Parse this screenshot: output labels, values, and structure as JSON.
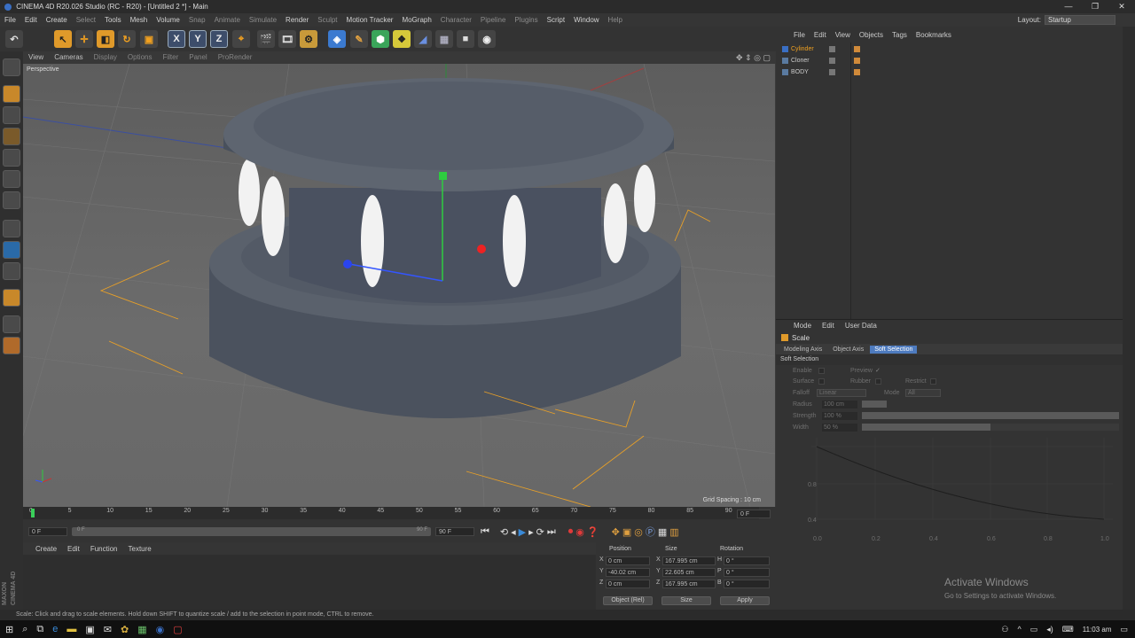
{
  "window": {
    "title": "CINEMA 4D R20.026 Studio (RC - R20) - [Untitled 2 *] - Main",
    "controls": [
      "—",
      "❐",
      "✕"
    ]
  },
  "menubar": {
    "items": [
      "File",
      "Edit",
      "Create",
      "Select",
      "Tools",
      "Mesh",
      "Volume",
      "Snap",
      "Animate",
      "Simulate",
      "Render",
      "Sculpt",
      "Motion Tracker",
      "MoGraph",
      "Character",
      "Pipeline",
      "Plugins",
      "Script",
      "Window",
      "Help"
    ],
    "layout_label": "Layout:",
    "layout_value": "Startup"
  },
  "toolbar": {
    "axis_labels": [
      "X",
      "Y",
      "Z"
    ]
  },
  "viewport_menu": {
    "items": [
      "View",
      "Cameras",
      "Display",
      "Options",
      "Filter",
      "Panel",
      "ProRender"
    ]
  },
  "viewport": {
    "label": "Perspective",
    "grid_spacing": "Grid Spacing : 10 cm"
  },
  "timeline": {
    "ticks": [
      "0",
      "5",
      "10",
      "15",
      "20",
      "25",
      "30",
      "35",
      "40",
      "45",
      "50",
      "55",
      "60",
      "65",
      "70",
      "75",
      "80",
      "85",
      "90"
    ],
    "current_frame": "0 F",
    "start_field": "0 F",
    "range_start": "0 F",
    "range_end": "90 F",
    "end_field": "90 F"
  },
  "material_manager": {
    "menu": [
      "Create",
      "Edit",
      "Function",
      "Texture"
    ]
  },
  "brand": {
    "maxon": "MAXON",
    "c4d": "CINEMA 4D"
  },
  "coordinates": {
    "headers": [
      "Position",
      "Size",
      "Rotation"
    ],
    "rows": [
      {
        "axis": "X",
        "pos": "0 cm",
        "size_axis": "X",
        "size": "167.995 cm",
        "rot_axis": "H",
        "rot": "0 °"
      },
      {
        "axis": "Y",
        "pos": "-40.02 cm",
        "size_axis": "Y",
        "size": "22.605 cm",
        "rot_axis": "P",
        "rot": "0 °"
      },
      {
        "axis": "Z",
        "pos": "0 cm",
        "size_axis": "Z",
        "size": "167.995 cm",
        "rot_axis": "B",
        "rot": "0 °"
      }
    ],
    "mode_select": "Object (Rel)",
    "size_select": "Size",
    "apply": "Apply"
  },
  "object_manager": {
    "menu": [
      "File",
      "Edit",
      "View",
      "Objects",
      "Tags",
      "Bookmarks"
    ],
    "objects": [
      {
        "name": "Cylinder",
        "selected": true
      },
      {
        "name": "Cloner",
        "selected": false
      },
      {
        "name": "BODY",
        "selected": false
      }
    ]
  },
  "attribute_manager": {
    "menu": [
      "Mode",
      "Edit",
      "User Data"
    ],
    "tool_name": "Scale",
    "tabs": [
      "Modeling Axis",
      "Object Axis",
      "Soft Selection"
    ],
    "active_tab": "Soft Selection",
    "section": "Soft Selection",
    "enable": "Enable",
    "preview": "Preview",
    "preview_check": "✓",
    "surface": "Surface",
    "rubber": "Rubber",
    "restrict": "Restrict",
    "falloff_label": "Falloff",
    "falloff_value": "Linear",
    "mode_label": "Mode",
    "mode_value": "All",
    "radius_label": "Radius",
    "radius_value": "100 cm",
    "strength_label": "Strength",
    "strength_value": "100 %",
    "width_label": "Width",
    "width_value": "50 %",
    "graph_y": [
      "0.8",
      "0.4"
    ],
    "graph_x": [
      "0.0",
      "0.2",
      "0.4",
      "0.6",
      "0.8",
      "1.0"
    ],
    "strength_fraction": 1.0,
    "width_fraction": 0.5
  },
  "activate": {
    "title": "Activate Windows",
    "subtitle": "Go to Settings to activate Windows."
  },
  "status": "Scale: Click and drag to scale elements. Hold down SHIFT to quantize scale / add to the selection in point mode, CTRL to remove.",
  "taskbar": {
    "time": "11:03 am"
  }
}
